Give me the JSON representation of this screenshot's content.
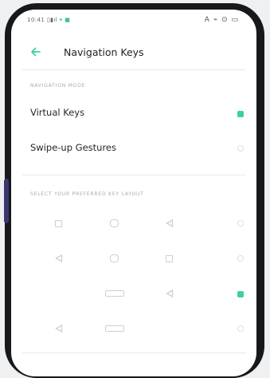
{
  "status_bar": {
    "left_text": "10:41",
    "signal": "▯▮ıl",
    "right_icons": "A ⌁ ⊙ ▭"
  },
  "header": {
    "title": "Navigation Keys"
  },
  "navigation_mode": {
    "section_label": "NAVIGATION MODE",
    "options": [
      {
        "label": "Virtual Keys",
        "selected": true
      },
      {
        "label": "Swipe-up Gestures",
        "selected": false
      }
    ]
  },
  "key_layout": {
    "section_label": "SELECT YOUR PREFERRED KEY LAYOUT",
    "rows": [
      {
        "keys": [
          "square",
          "home",
          "back"
        ],
        "selected": false
      },
      {
        "keys": [
          "back",
          "home",
          "square"
        ],
        "selected": false
      },
      {
        "keys": [
          "pill",
          "back"
        ],
        "selected": true
      },
      {
        "keys": [
          "back",
          "pill"
        ],
        "selected": false
      }
    ]
  },
  "colors": {
    "accent": "#3fcf9a",
    "background": "#ffffff",
    "bezel": "#16181b"
  }
}
